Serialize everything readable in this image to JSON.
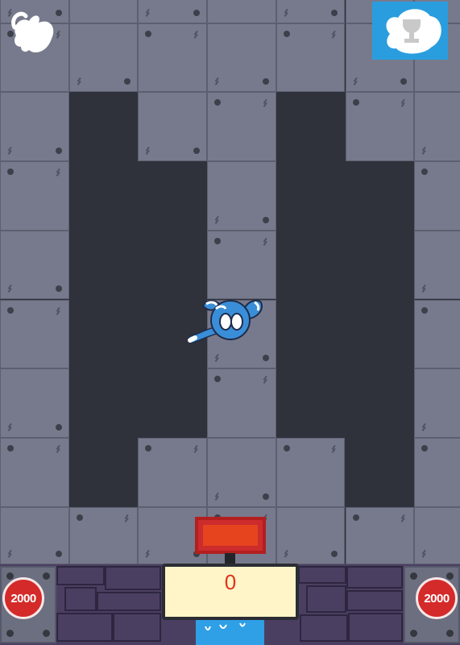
{
  "game": {
    "score": "0",
    "coin_costs": {
      "left": "2000",
      "right": "2000"
    }
  },
  "hud": {
    "restart_icon": "restart-blob-icon",
    "trophy_icon": "trophy-icon"
  },
  "colors": {
    "tile": "#777a8c",
    "pit": "#2f323a",
    "accent_blue": "#2a9ddf",
    "score_text": "#e0341c",
    "coin_red": "#d42a2a"
  }
}
